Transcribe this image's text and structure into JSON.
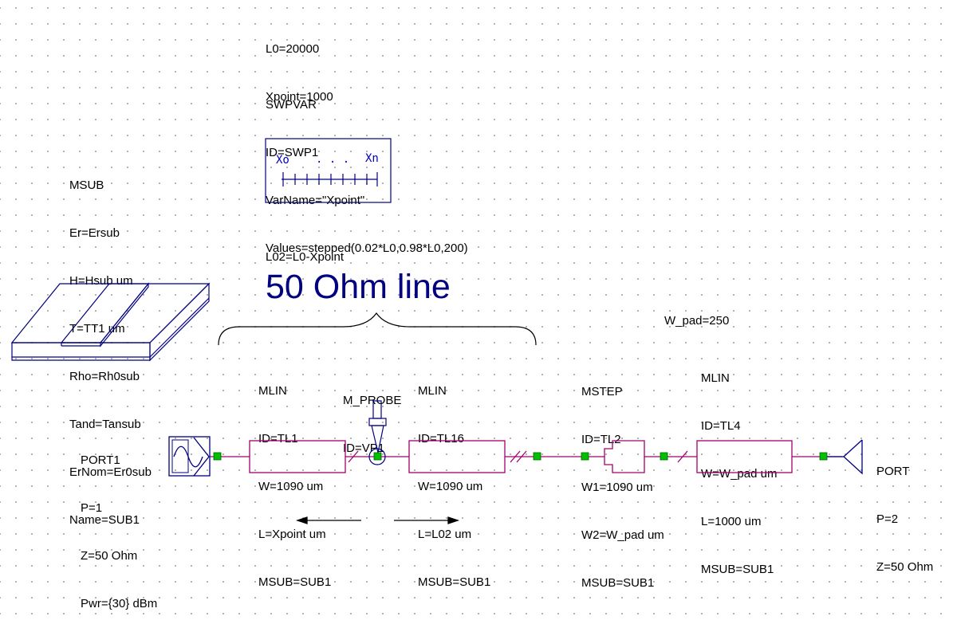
{
  "variables": {
    "l0": "L0=20000",
    "xpoint": "Xpoint=1000",
    "l02": "L02=L0-Xpoint",
    "w_pad": "W_pad=250"
  },
  "swpvar": {
    "lines": [
      "SWPVAR",
      "ID=SWP1",
      "VarName=\"Xpoint\"",
      "Values=stepped(0.02*L0,0.98*L0,200)"
    ],
    "icon_start": "Xo",
    "icon_dots": ". . .",
    "icon_end": "Xn"
  },
  "msub": {
    "lines": [
      "MSUB",
      "Er=Ersub",
      "H=Hsub um",
      "T=TT1 um",
      "Rho=Rh0sub",
      "Tand=Tansub",
      "ErNom=Er0sub",
      "Name=SUB1"
    ]
  },
  "title": "50 Ohm line",
  "port1": {
    "lines": [
      "PORT1",
      "P=1",
      "Z=50 Ohm",
      "Pwr={30} dBm"
    ]
  },
  "mlin_tl1": {
    "lines": [
      "MLIN",
      "ID=TL1",
      "W=1090 um",
      "L=Xpoint um",
      "MSUB=SUB1"
    ]
  },
  "probe": {
    "lines": [
      "M_PROBE",
      "ID=VP1"
    ]
  },
  "mlin_tl16": {
    "lines": [
      "MLIN",
      "ID=TL16",
      "W=1090 um",
      "L=L02 um",
      "MSUB=SUB1"
    ]
  },
  "mstep": {
    "lines": [
      "MSTEP",
      "ID=TL2",
      "W1=1090 um",
      "W2=W_pad um",
      "MSUB=SUB1"
    ]
  },
  "mlin_tl4": {
    "lines": [
      "MLIN",
      "ID=TL4",
      "W=W_pad um",
      "L=1000 um",
      "MSUB=SUB1"
    ]
  },
  "port2": {
    "lines": [
      "PORT",
      "P=2",
      "Z=50 Ohm"
    ]
  },
  "colors": {
    "wire": "#a0006e",
    "node": "#00c000",
    "symbol_blue": "#000080",
    "title_blue": "#000080",
    "sweep_blue": "#0000c0"
  }
}
